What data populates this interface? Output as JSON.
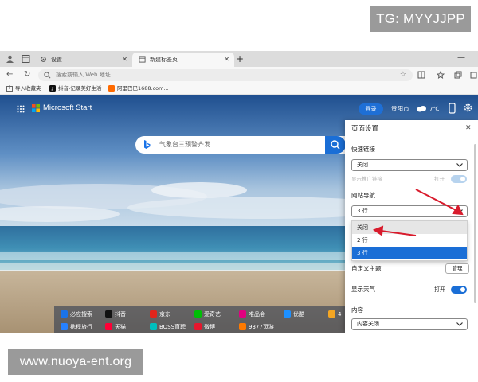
{
  "watermark_top": "TG: MYYJJPP",
  "watermark_bottom": "www.nuoya-ent.org",
  "tabs": [
    {
      "label": "设置",
      "active": false
    },
    {
      "label": "新建标签页",
      "active": true
    }
  ],
  "addressbar": {
    "placeholder": "搜索或输入 Web 地址"
  },
  "favorites": [
    {
      "label": "导入收藏夹"
    },
    {
      "label": "抖音-记录美好生活"
    },
    {
      "label": "阿里巴巴1688.com..."
    }
  ],
  "header": {
    "brand": "Microsoft Start",
    "login_label": "登录",
    "city": "贵阳市",
    "temperature": "7℃"
  },
  "search": {
    "placeholder": "气象台三预警齐发"
  },
  "quick_links": [
    {
      "label": "必应搜索",
      "color": "#1a73e8"
    },
    {
      "label": "抖音",
      "color": "#111111"
    },
    {
      "label": "京东",
      "color": "#e1251b"
    },
    {
      "label": "爱奇艺",
      "color": "#00be06"
    },
    {
      "label": "唯品会",
      "color": "#e0007f"
    },
    {
      "label": "优酷",
      "color": "#1e90ff"
    },
    {
      "label": "4",
      "color": "#f5a623"
    },
    {
      "label": "携程旅行",
      "color": "#2681ff"
    },
    {
      "label": "天猫",
      "color": "#ff0036"
    },
    {
      "label": "BOSS直聘",
      "color": "#00bebd"
    },
    {
      "label": "微博",
      "color": "#e6162d"
    },
    {
      "label": "9377页游",
      "color": "#ff7a00"
    }
  ],
  "settings_panel": {
    "title": "页面设置",
    "quick_links_heading": "快速链接",
    "quick_links_value": "关闭",
    "show_promoted_label": "显示推广链接",
    "show_promoted_state": "打开",
    "site_nav_heading": "网站导航",
    "site_nav_value": "3 行",
    "site_nav_options": [
      "关闭",
      "2 行",
      "3 行"
    ],
    "custom_theme_label": "自定义主题",
    "manage_label": "管理",
    "show_weather_label": "显示天气",
    "show_weather_state": "打开",
    "content_heading": "内容",
    "content_value": "内容关闭"
  },
  "colors": {
    "accent": "#1a6ed6",
    "arrow": "#d81b2c"
  }
}
